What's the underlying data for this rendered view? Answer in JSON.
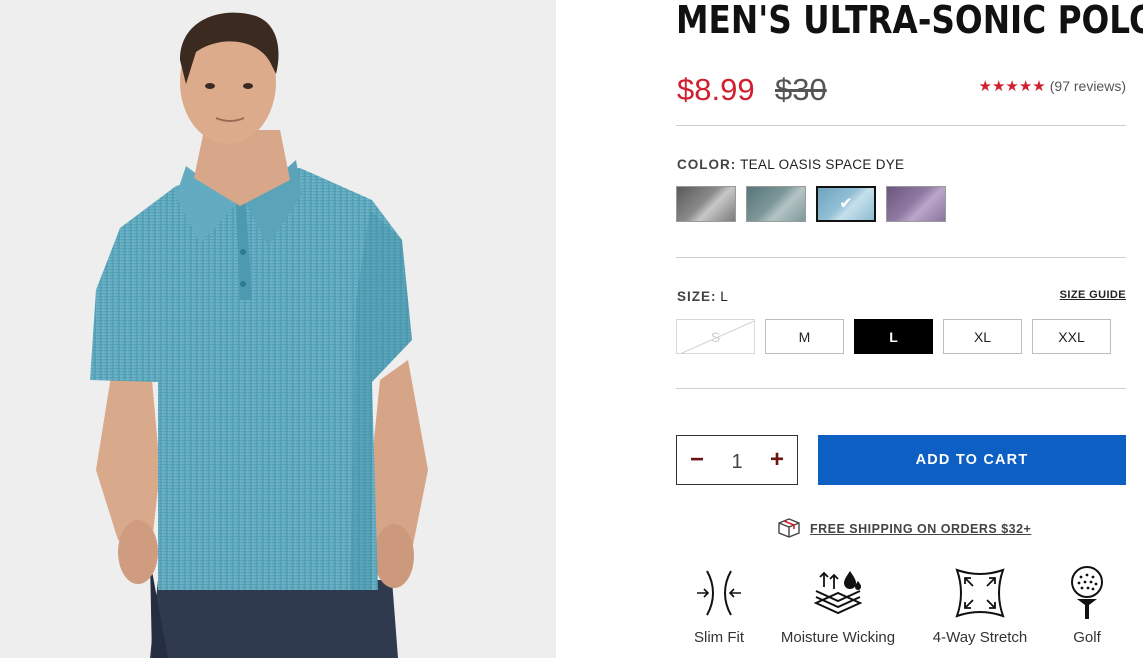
{
  "product": {
    "title": "MEN'S ULTRA-SONIC POLO",
    "sale_price": "$8.99",
    "original_price": "$30",
    "rating_stars": "★★★★★",
    "reviews": "(97 reviews)"
  },
  "color": {
    "label": "COLOR:",
    "value": "TEAL OASIS SPACE DYE",
    "swatches": [
      {
        "name": "charcoal",
        "colors": [
          "#5a5a5a",
          "#b5b5b5"
        ]
      },
      {
        "name": "slate",
        "colors": [
          "#5d7c7f",
          "#a3b5b6"
        ]
      },
      {
        "name": "teal-oasis",
        "colors": [
          "#6fa3bf",
          "#c0dbe8"
        ],
        "selected": true
      },
      {
        "name": "purple",
        "colors": [
          "#6e5a82",
          "#b49bc0"
        ]
      }
    ],
    "check": "✔"
  },
  "size": {
    "label": "SIZE:",
    "value": "L",
    "guide": "SIZE GUIDE",
    "options": [
      "S",
      "M",
      "L",
      "XL",
      "XXL"
    ],
    "selected": "L",
    "unavailable": [
      "S"
    ]
  },
  "cart": {
    "minus": "−",
    "quantity": "1",
    "plus": "+",
    "add_label": "ADD TO CART"
  },
  "shipping": {
    "text": "FREE SHIPPING ON ORDERS $32+",
    "icon": "package-icon"
  },
  "features": [
    {
      "label": "Slim Fit",
      "icon": "slim-fit-icon"
    },
    {
      "label": "Moisture Wicking",
      "icon": "moisture-wicking-icon"
    },
    {
      "label": "4-Way Stretch",
      "icon": "four-way-stretch-icon"
    },
    {
      "label": "Golf",
      "icon": "golf-icon"
    }
  ],
  "colors": {
    "sale": "#d0202f",
    "cta": "#0d5fc4",
    "stars": "#d0202f"
  }
}
